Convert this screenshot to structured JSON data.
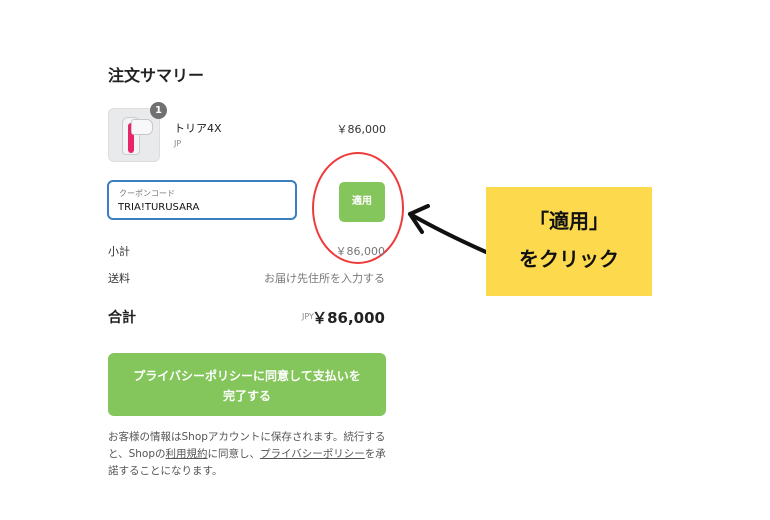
{
  "summary": {
    "title": "注文サマリー",
    "product": {
      "name": "トリア4X",
      "variant": "JP",
      "price": "￥86,000",
      "quantity": "1"
    },
    "coupon": {
      "label": "クーポンコード",
      "value": "TRIA!TURUSARA",
      "apply_label": "適用"
    },
    "subtotal": {
      "label": "小計",
      "value": "￥86,000"
    },
    "shipping": {
      "label": "送料",
      "value": "お届け先住所を入力する"
    },
    "total": {
      "label": "合計",
      "currency": "JPY",
      "value": "￥86,000"
    },
    "pay_button": {
      "line1": "プライバシーポリシーに同意して支払いを",
      "line2": "完了する"
    },
    "footer": {
      "part1": "お客様の情報はShopアカウントに保存されます。続行すると、Shopの",
      "terms_link": "利用規約",
      "part2": "に同意し、",
      "privacy_link": "プライバシーポリシー",
      "part3": "を承諾することになります。"
    }
  },
  "annotation": {
    "line1": "「適用」",
    "line2": "をクリック"
  },
  "colors": {
    "accent_green": "#84c65b",
    "focus_blue": "#3a7fc1",
    "highlight_red": "#ee3b3b",
    "callout_yellow": "#fcd94d"
  }
}
